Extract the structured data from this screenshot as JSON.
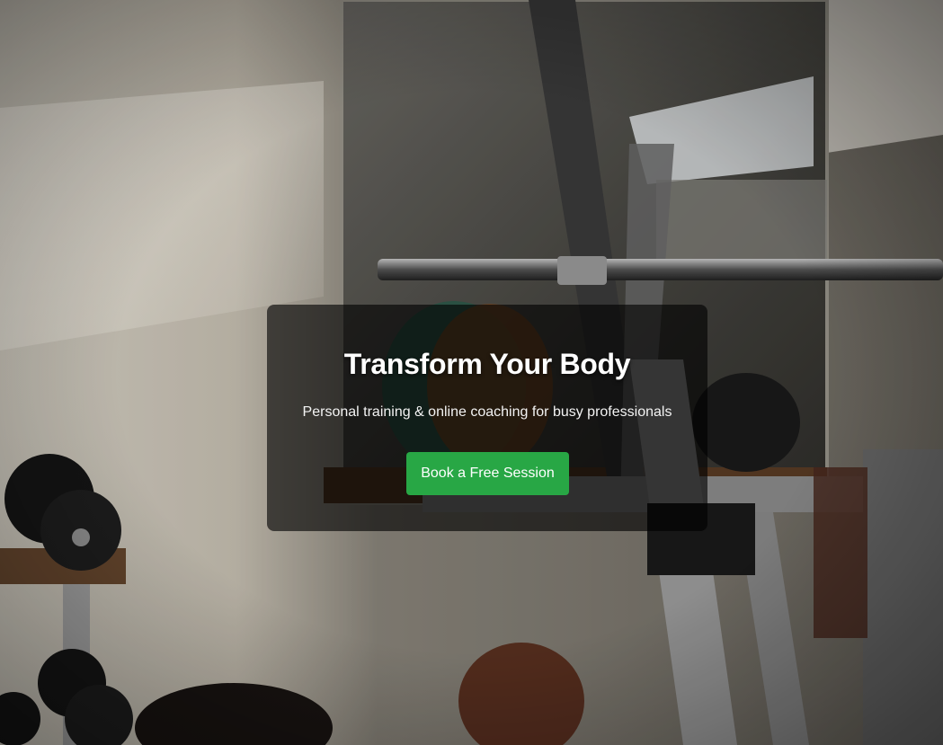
{
  "hero": {
    "title": "Transform Your Body",
    "subtitle": "Personal training & online coaching for busy professionals",
    "cta_label": "Book a Free Session",
    "background_image": "gym-equipment-photo"
  },
  "colors": {
    "cta_background": "#28a745",
    "card_overlay": "rgba(0,0,0,0.62)",
    "text": "#ffffff"
  }
}
